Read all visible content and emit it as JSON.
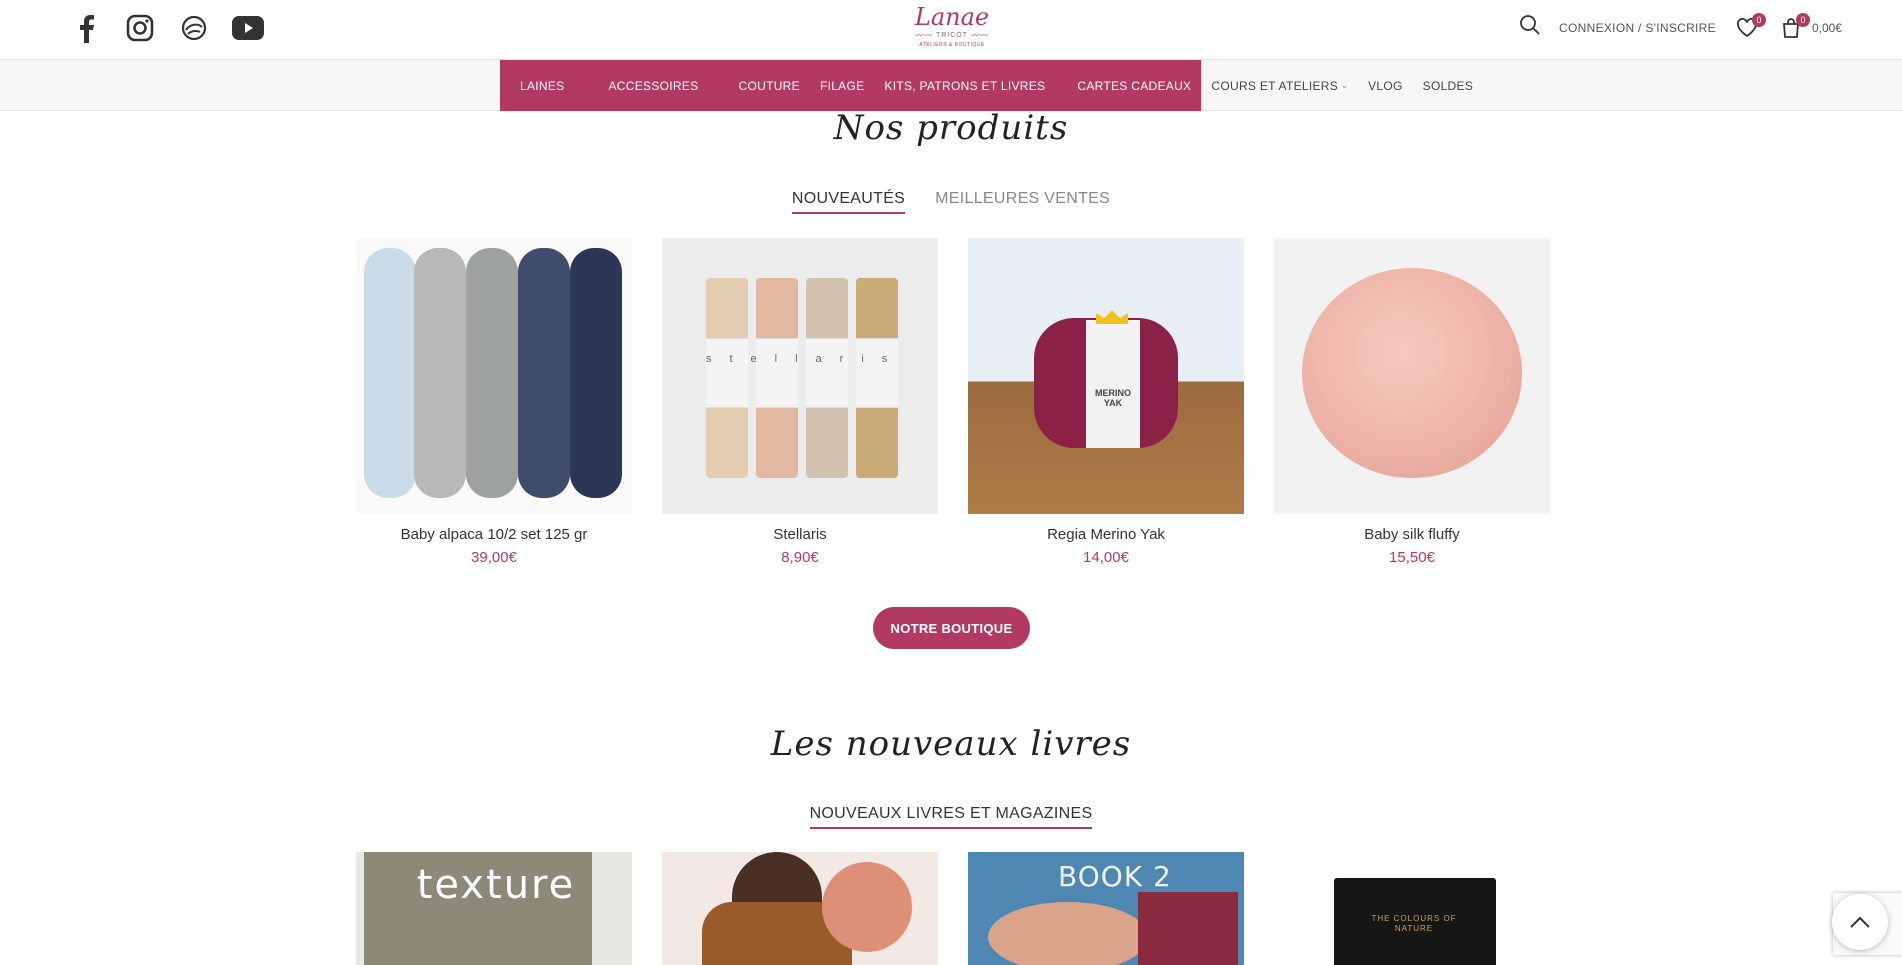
{
  "header": {
    "social_icons": [
      "facebook-icon",
      "instagram-icon",
      "ravelry-icon",
      "youtube-icon"
    ],
    "logo": {
      "name": "Lanae",
      "subtitle": "TRICOT",
      "tagline": "ATELIERS & BOUTIQUE"
    },
    "login_label": "CONNEXION / S'INSCRIRE",
    "wishlist_count": "0",
    "cart_count": "0",
    "cart_total": "0,00€"
  },
  "nav": {
    "highlighted": [
      {
        "label": "LAINES"
      },
      {
        "label": "ACCESSOIRES"
      },
      {
        "label": "COUTURE"
      },
      {
        "label": "FILAGE"
      },
      {
        "label": "KITS, PATRONS ET LIVRES"
      },
      {
        "label": "CARTES CADEAUX"
      }
    ],
    "regular": [
      {
        "label": "COURS ET ATELIERS"
      },
      {
        "label": "VLOG"
      },
      {
        "label": "SOLDES"
      }
    ]
  },
  "products_section": {
    "title": "Nos produits",
    "tabs": [
      {
        "label": "NOUVEAUTÉS",
        "active": true
      },
      {
        "label": "MEILLEURES VENTES",
        "active": false
      }
    ],
    "items": [
      {
        "name": "Baby alpaca 10/2 set 125 gr",
        "price": "39,00€"
      },
      {
        "name": "Stellaris",
        "price": "8,90€"
      },
      {
        "name": "Regia Merino Yak",
        "price": "14,00€"
      },
      {
        "name": "Baby silk fluffy",
        "price": "15,50€"
      }
    ],
    "shop_button": "NOTRE BOUTIQUE"
  },
  "books_section": {
    "title": "Les nouveaux livres",
    "tab": "NOUVEAUX LIVRES ET MAGAZINES",
    "cover_texts": [
      "texture",
      "BOOK 2",
      "THE COLOURS OF NATURE"
    ]
  },
  "product_label_texts": {
    "stellaris": "stellaris",
    "regia": "MERINO YAK"
  },
  "colors": {
    "accent": "#b23a62"
  }
}
